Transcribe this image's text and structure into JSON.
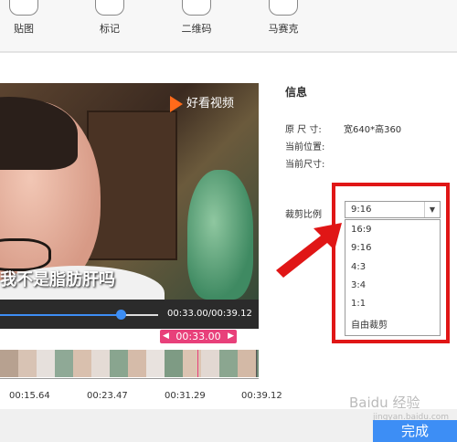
{
  "toolbar": {
    "items": [
      {
        "label": "贴图"
      },
      {
        "label": "标记"
      },
      {
        "label": "二维码"
      },
      {
        "label": "马赛克"
      }
    ]
  },
  "video": {
    "logo_text": "好看视频",
    "subtitle": "我不是脂肪肝吗",
    "time_readout": "00:33.00/00:39.12",
    "progress_fraction": 0.84
  },
  "timeline": {
    "cursor_time": "00:33.00",
    "tick_labels": [
      "00:15.64",
      "00:23.47",
      "00:31.29",
      "00:39.12"
    ]
  },
  "info": {
    "title": "信息",
    "rows": [
      {
        "label": "原 尺 寸:",
        "value": "宽640*高360"
      },
      {
        "label": "当前位置:",
        "value": ""
      },
      {
        "label": "当前尺寸:",
        "value": ""
      }
    ],
    "crop_label": "裁剪比例",
    "crop_selected": "9:16",
    "crop_options": [
      "16:9",
      "9:16",
      "4:3",
      "3:4",
      "1:1",
      "自由裁剪"
    ]
  },
  "footer": {
    "watermark": "Baidu 经验",
    "watermark_sub": "jingyan.baidu.com",
    "done_label": "完成"
  }
}
